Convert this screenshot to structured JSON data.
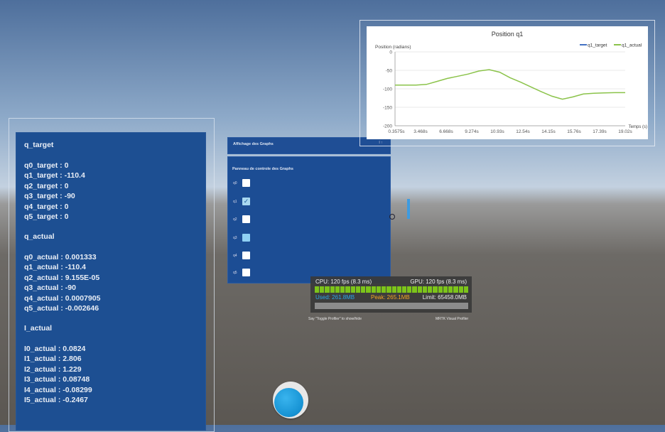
{
  "left_panel": {
    "heading_target": "q_target",
    "target_lines": [
      "q0_target : 0",
      "q1_target : -110.4",
      "q2_target : 0",
      "q3_target : -90",
      "q4_target : 0",
      "q5_target : 0"
    ],
    "heading_actual": "q_actual",
    "actual_lines": [
      "q0_actual  : 0.001333",
      "q1_actual  : -110.4",
      "q2_actual  : 9.155E-05",
      "q3_actual  : -90",
      "q4_actual  : 0.0007905",
      "q5_actual  : -0.002646"
    ],
    "heading_current": "I_actual",
    "current_lines": [
      "I0_actual : 0.0824",
      "I1_actual : 2.806",
      "I2_actual : 1.229",
      "I3_actual : 0.08748",
      "I4_actual : -0.08299",
      "I5_actual : -0.2467"
    ]
  },
  "graph_header": {
    "title": "Affichage des Graphs",
    "button_label": "I ↑"
  },
  "control_panel": {
    "title": "Panneau de controle des Graphs",
    "checkboxes": [
      {
        "label": "q0",
        "state": "unchecked"
      },
      {
        "label": "q1",
        "state": "checked"
      },
      {
        "label": "q2",
        "state": "unchecked"
      },
      {
        "label": "q3",
        "state": "highlighted"
      },
      {
        "label": "q4",
        "state": "unchecked"
      },
      {
        "label": "q5",
        "state": "unchecked"
      }
    ]
  },
  "chart_data": {
    "type": "line",
    "title": "Position q1",
    "ylabel": "Position (radians)",
    "xlabel": "Temps (s)",
    "ylim": [
      -200,
      0
    ],
    "yticks": [
      "0",
      "-50",
      "-100",
      "-150",
      "-200"
    ],
    "xticks": [
      "0.3575s",
      "3.468s",
      "6.668s",
      "9.274s",
      "10.93s",
      "12.54s",
      "14.15s",
      "15.76s",
      "17.39s",
      "19.02s"
    ],
    "legend": [
      {
        "name": "q1_target",
        "color": "#4472c4"
      },
      {
        "name": "q1_actual",
        "color": "#8bc34a"
      }
    ],
    "legend_position": "top-right",
    "grid": true,
    "series": [
      {
        "name": "q1_actual",
        "color": "#8bc34a",
        "values": [
          -90,
          -90,
          -90,
          -88,
          -80,
          -72,
          -66,
          -60,
          -52,
          -48,
          -55,
          -70,
          -82,
          -95,
          -108,
          -120,
          -128,
          -122,
          -114,
          -112,
          -111,
          -110.4,
          -110.4
        ]
      }
    ]
  },
  "perf": {
    "cpu": "CPU: 120 fps (8.3 ms)",
    "gpu": "GPU: 120 fps (8.3 ms)",
    "used": "Used: 261.8MB",
    "peak": "Peak: 265.1MB",
    "limit": "Limit: 65458.0MB",
    "used_color": "#2aa7e8",
    "peak_color": "#f5a623",
    "foot_left": "Say \"Toggle Profiler\" to show/hide",
    "foot_right": "MRTK Visual Profiler"
  }
}
